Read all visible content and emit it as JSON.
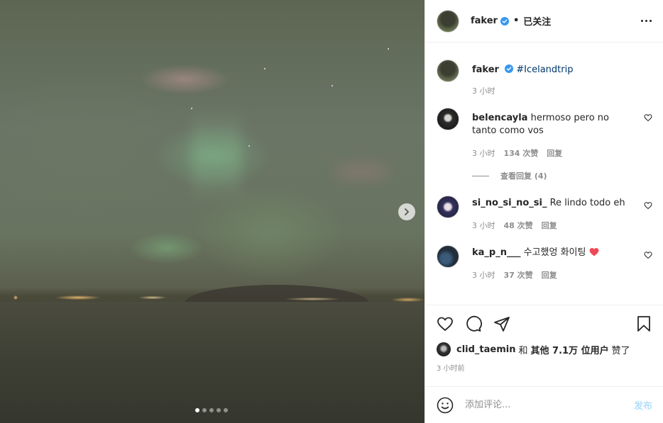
{
  "post": {
    "author": "faker",
    "separator": "•",
    "follow_status": "已关注",
    "caption_hashtag": "#Icelandtrip",
    "caption_time": "3 小时",
    "image_dots_count": 5,
    "active_dot": 1
  },
  "comments": [
    {
      "username": "belencayla",
      "text": "hermoso pero no tanto como vos",
      "time": "3 小时",
      "likes": "134 次赞",
      "reply": "回复",
      "view_replies": "查看回复 (4)"
    },
    {
      "username": "si_no_si_no_si_",
      "text": "Re lindo todo eh",
      "time": "3 小时",
      "likes": "48 次赞",
      "reply": "回复"
    },
    {
      "username": "ka_p_n___",
      "text": "수고했엉 화이팅",
      "emoji": "red-heart-emoji",
      "time": "3 小时",
      "likes": "37 次赞",
      "reply": "回复"
    }
  ],
  "likes_summary": {
    "user": "clid_taemin",
    "and": "和",
    "others": "其他 7.1万 位用户",
    "liked": "赞了"
  },
  "timestamp": "3 小时前",
  "add_comment": {
    "placeholder": "添加评论...",
    "post_label": "发布"
  },
  "colors": {
    "verified": "#3897f0",
    "link": "#00376b",
    "muted": "#8e8e8e",
    "post_button": "#b2dffc",
    "heart_emoji": "#ed4956"
  }
}
